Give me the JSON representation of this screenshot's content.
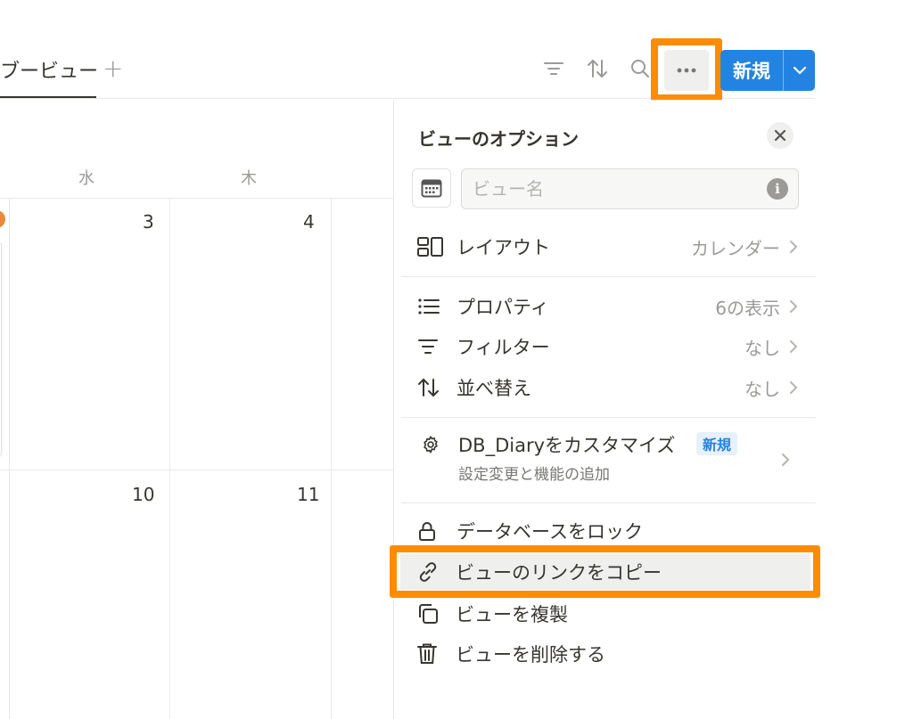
{
  "header": {
    "view_tab_label": "ブービュー",
    "add_view_label": "+",
    "new_button_label": "新規"
  },
  "calendar": {
    "weekdays": [
      "水",
      "木"
    ],
    "days": [
      "3",
      "4",
      "10",
      "11"
    ]
  },
  "panel": {
    "title": "ビューのオプション",
    "name_placeholder": "ビュー名",
    "layout": {
      "label": "レイアウト",
      "value": "カレンダー"
    },
    "properties": {
      "label": "プロパティ",
      "value": "6の表示"
    },
    "filter": {
      "label": "フィルター",
      "value": "なし"
    },
    "sort": {
      "label": "並べ替え",
      "value": "なし"
    },
    "customize": {
      "label": "DB_Diaryをカスタマイズ",
      "badge": "新規",
      "sub": "設定変更と機能の追加"
    },
    "lock": {
      "label": "データベースをロック"
    },
    "copy_link": {
      "label": "ビューのリンクをコピー"
    },
    "duplicate": {
      "label": "ビューを複製"
    },
    "delete": {
      "label": "ビューを削除する"
    }
  },
  "colors": {
    "accent": "#2383e2",
    "highlight": "#ff8c00",
    "text": "#37352f",
    "muted": "#9b9a97"
  }
}
